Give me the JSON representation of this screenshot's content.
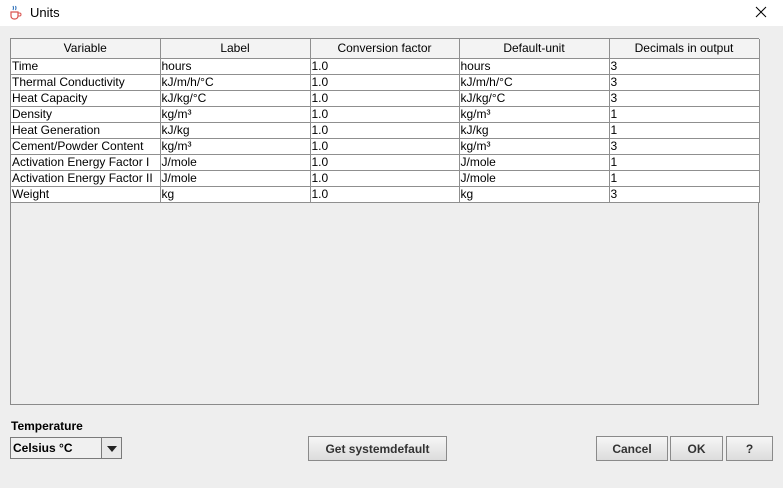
{
  "window": {
    "title": "Units",
    "app_icon": "java-cup-icon",
    "close_icon": "close-icon"
  },
  "table": {
    "columns": [
      "Variable",
      "Label",
      "Conversion factor",
      "Default-unit",
      "Decimals in output"
    ],
    "rows": [
      [
        "Time",
        "hours",
        "1.0",
        "hours",
        "3"
      ],
      [
        "Thermal Conductivity",
        "kJ/m/h/°C",
        "1.0",
        "kJ/m/h/°C",
        "3"
      ],
      [
        "Heat Capacity",
        "kJ/kg/°C",
        "1.0",
        "kJ/kg/°C",
        "3"
      ],
      [
        "Density",
        "kg/m³",
        "1.0",
        "kg/m³",
        "1"
      ],
      [
        "Heat Generation",
        "kJ/kg",
        "1.0",
        "kJ/kg",
        "1"
      ],
      [
        "Cement/Powder Content",
        "kg/m³",
        "1.0",
        "kg/m³",
        "3"
      ],
      [
        "Activation Energy Factor I",
        "J/mole",
        "1.0",
        "J/mole",
        "1"
      ],
      [
        "Activation Energy Factor II",
        "J/mole",
        "1.0",
        "J/mole",
        "1"
      ],
      [
        "Weight",
        "kg",
        "1.0",
        "kg",
        "3"
      ]
    ]
  },
  "temperature": {
    "label": "Temperature",
    "selected": "Celsius °C",
    "arrow_icon": "chevron-down-icon"
  },
  "buttons": {
    "systemdefault": "Get systemdefault",
    "cancel": "Cancel",
    "ok": "OK",
    "help": "?"
  }
}
